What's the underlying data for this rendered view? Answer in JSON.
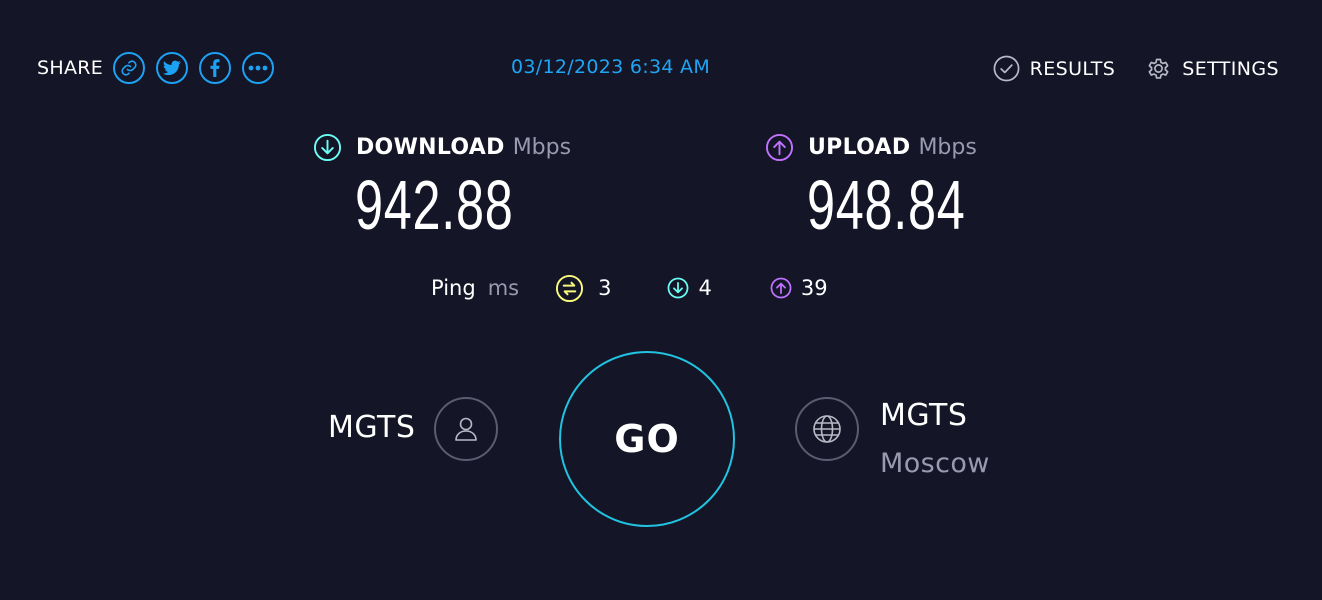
{
  "header": {
    "share_label": "SHARE",
    "share_buttons": [
      {
        "icon": "link-icon"
      },
      {
        "icon": "twitter-icon"
      },
      {
        "icon": "facebook-icon"
      },
      {
        "icon": "more-icon"
      }
    ],
    "timestamp": "03/12/2023 6:34 AM",
    "results_label": "RESULTS",
    "settings_label": "SETTINGS"
  },
  "download": {
    "title": "DOWNLOAD",
    "unit": "Mbps",
    "value": "942.88",
    "color": "#6afff3"
  },
  "upload": {
    "title": "UPLOAD",
    "unit": "Mbps",
    "value": "948.84",
    "color": "#bf71ff"
  },
  "ping": {
    "label": "Ping",
    "unit": "ms",
    "idle": "3",
    "idle_color": "#fbfc7d",
    "download": "4",
    "upload": "39"
  },
  "connection": {
    "isp": "MGTS",
    "server_name": "MGTS",
    "server_location": "Moscow"
  },
  "go_button": {
    "label": "GO",
    "ring_color": "#21c3e0"
  },
  "colors": {
    "background": "#141526",
    "accent_blue": "#1ea6f5",
    "muted": "#9a9aae"
  }
}
